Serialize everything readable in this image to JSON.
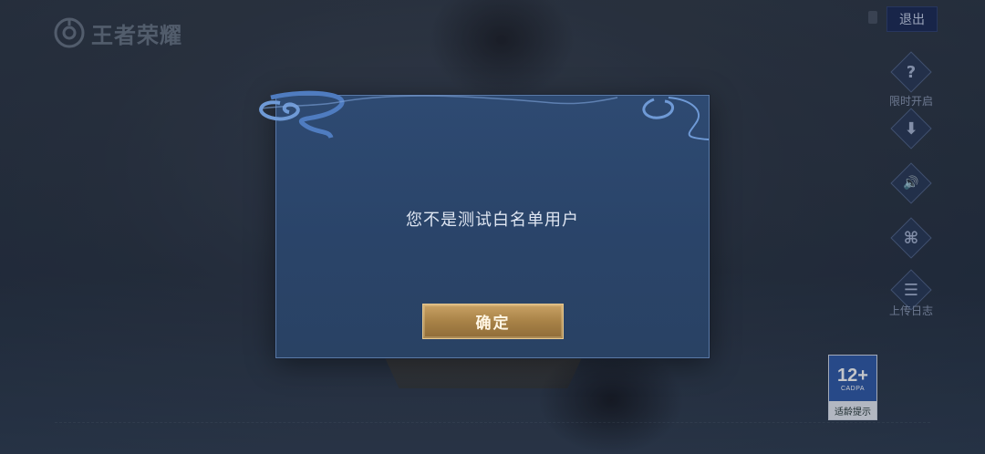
{
  "header": {
    "logo_text": "王者荣耀",
    "exit_label": "退出"
  },
  "sidebar": {
    "items": [
      {
        "icon": "question-icon",
        "glyph": "?",
        "label": "限时开启"
      },
      {
        "icon": "download-icon",
        "glyph": "⬇",
        "label": ""
      },
      {
        "icon": "sound-icon",
        "glyph": "🔊",
        "label": ""
      },
      {
        "icon": "bookmark-icon",
        "glyph": "⌘",
        "label": ""
      },
      {
        "icon": "notice-icon",
        "glyph": "☰",
        "label": "上传日志"
      }
    ]
  },
  "age_rating": {
    "value": "12+",
    "org": "CADPA",
    "caption": "适龄提示"
  },
  "dialog": {
    "message": "您不是测试白名单用户",
    "confirm_label": "确定"
  },
  "colors": {
    "dialog_bg": "#2b466b",
    "button_gold": "#b08a4e",
    "exit_bg": "#1b2a55"
  }
}
